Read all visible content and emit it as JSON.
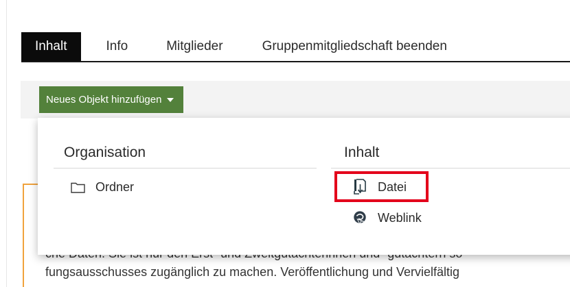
{
  "tabs": [
    {
      "label": "Inhalt",
      "active": true
    },
    {
      "label": "Info",
      "active": false
    },
    {
      "label": "Mitglieder",
      "active": false
    },
    {
      "label": "Gruppenmitgliedschaft beenden",
      "active": false
    }
  ],
  "toolbar": {
    "add_button_label": "Neues Objekt hinzufügen"
  },
  "dropdown": {
    "organisation": {
      "heading": "Organisation",
      "items": [
        {
          "label": "Ordner",
          "icon": "folder-icon"
        }
      ]
    },
    "content": {
      "heading": "Inhalt",
      "items": [
        {
          "label": "Datei",
          "icon": "file-icon",
          "highlighted": true
        },
        {
          "label": "Weblink",
          "icon": "weblink-icon"
        }
      ]
    }
  },
  "background_text": {
    "line1": "che Daten. Sie ist nur den Erst- und Zweitgutachterinnen und -gutachtern so",
    "line2": "fungsausschusses zugänglich zu machen. Veröffentlichung und Vervielfältig"
  },
  "colors": {
    "tab_active_bg": "#0b0b0b",
    "button_green": "#53813b",
    "highlight_red": "#e3001b",
    "accent_orange": "#f0a23c"
  }
}
